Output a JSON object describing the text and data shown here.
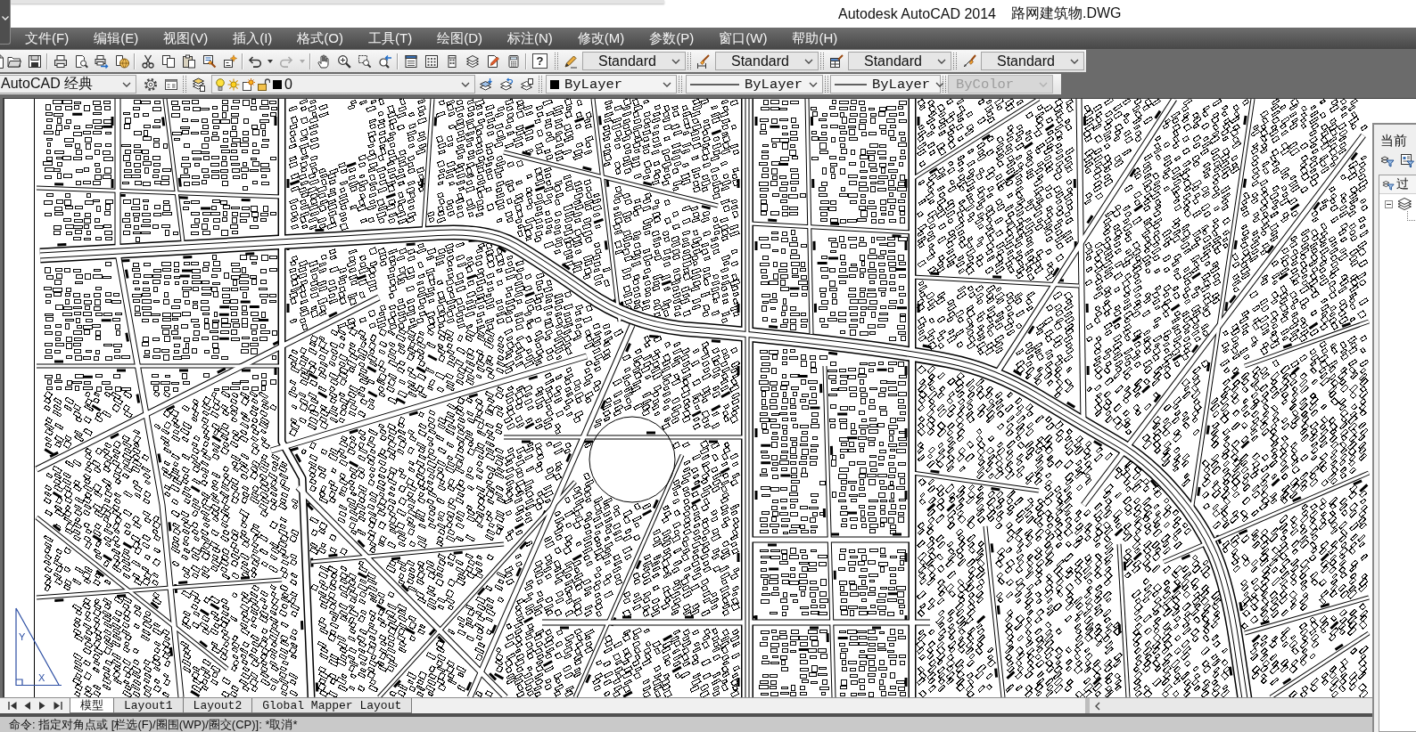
{
  "title_bar": {
    "app": "Autodesk AutoCAD 2014",
    "file": "路网建筑物.DWG"
  },
  "menu_bar": {
    "items": [
      "文件(F)",
      "编辑(E)",
      "视图(V)",
      "插入(I)",
      "格式(O)",
      "工具(T)",
      "绘图(D)",
      "标注(N)",
      "修改(M)",
      "参数(P)",
      "窗口(W)",
      "帮助(H)"
    ]
  },
  "standard_toolbar": {
    "undo": {
      "disabled": false
    },
    "redo": {
      "disabled": true
    },
    "help_button": "?"
  },
  "styles_toolbar": {
    "dropdowns": [
      {
        "kind": "text_style",
        "value": "Standard"
      },
      {
        "kind": "dim_style",
        "value": "Standard"
      },
      {
        "kind": "table_style",
        "value": "Standard"
      },
      {
        "kind": "mleader_style",
        "value": "Standard"
      }
    ]
  },
  "workspace_toolbar": {
    "workspace": "AutoCAD 经典"
  },
  "layers_toolbar": {
    "current_layer": "0"
  },
  "properties_toolbar": {
    "dropdowns": [
      {
        "kind": "color",
        "value": "ByLayer",
        "disabled": false
      },
      {
        "kind": "linetype",
        "value": "ByLayer",
        "disabled": false
      },
      {
        "kind": "lineweight",
        "value": "ByLayer",
        "disabled": false
      },
      {
        "kind": "plot_style",
        "value": "ByColor",
        "disabled": true
      }
    ]
  },
  "drawing": {
    "ucs_icon": {
      "x_label": "X",
      "y_label": "Y"
    }
  },
  "layer_palette": {
    "title": "当前",
    "filter_header": "过",
    "tree_expanded": true
  },
  "layout_tabs": [
    {
      "label": "模型",
      "selected": true
    },
    {
      "label": "Layout1",
      "selected": false
    },
    {
      "label": "Layout2",
      "selected": false
    },
    {
      "label": "Global Mapper Layout",
      "selected": false
    }
  ],
  "command_line": {
    "text": "命令: 指定对角点或 [栏选(F)/圈围(WP)/圈交(CP)]: *取消*"
  }
}
